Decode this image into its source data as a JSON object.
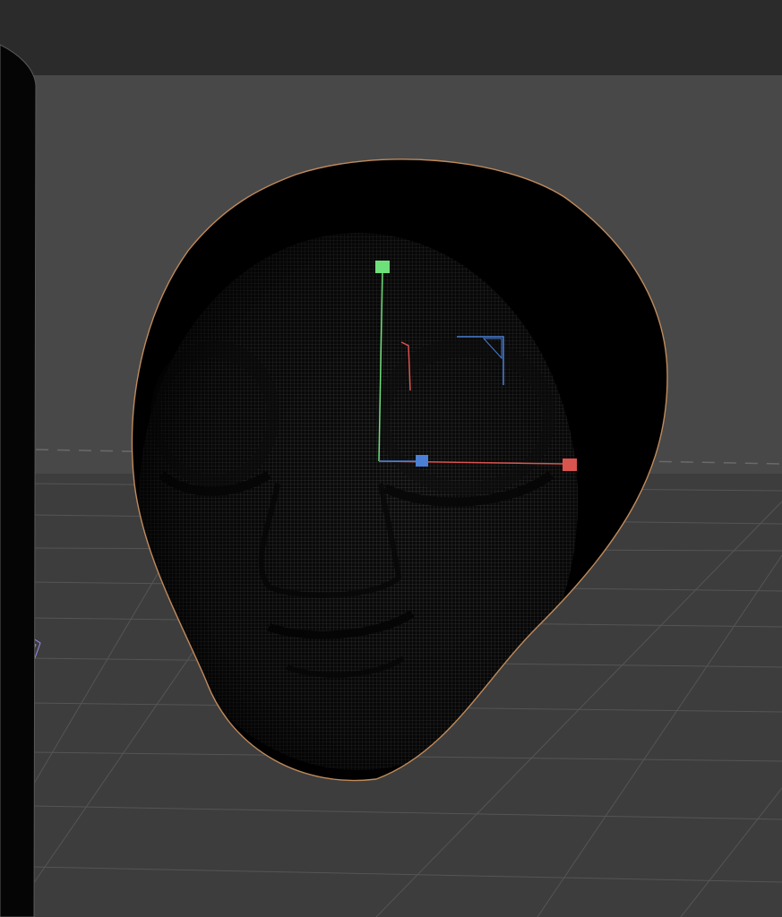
{
  "app": {
    "title": ""
  },
  "viewport": {
    "background_color": "#474747",
    "floor_color": "#3e3e3e",
    "grid_line_color": "#525252",
    "horizon_line_color": "#6a6a6a",
    "top_bar_color": "#2b2b2b"
  },
  "object": {
    "name": "",
    "type": "sculpt-head-mesh",
    "selected": true,
    "outline_color": "#c08a5a",
    "wire_color": "#9a9a9a"
  },
  "gizmo": {
    "x_axis_color": "#d9534f",
    "y_axis_color": "#6ee07a",
    "z_axis_color": "#4a7fd4",
    "center_color": "#4a7fd4"
  },
  "camera": {
    "icon": "camera-frustum-icon",
    "color": "#9a8cf0"
  },
  "side_object": {
    "color": "#050505",
    "outline_color": "#5a5a5a"
  }
}
